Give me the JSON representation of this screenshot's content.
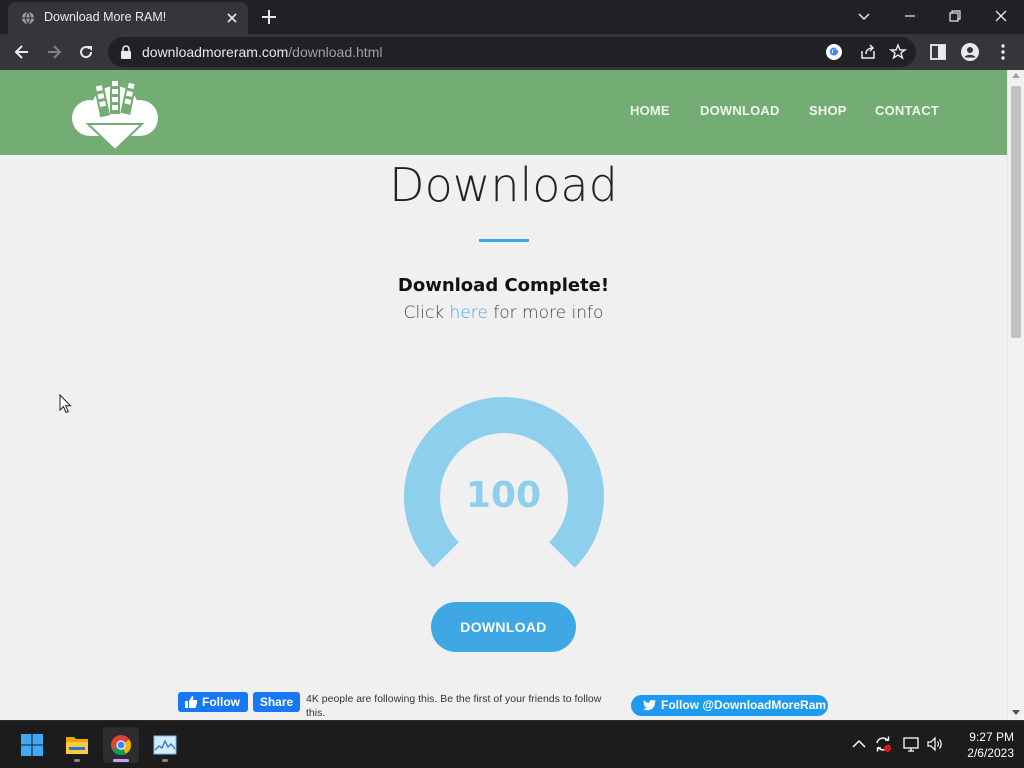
{
  "browser": {
    "tab_title": "Download More RAM!",
    "url_domain": "downloadmoreram.com",
    "url_path": "/download.html"
  },
  "site": {
    "nav": [
      "HOME",
      "DOWNLOAD",
      "SHOP",
      "CONTACT"
    ],
    "page_title": "Download",
    "status_heading": "Download Complete!",
    "info_prefix": "Click ",
    "info_link": "here",
    "info_suffix": " for more info",
    "progress_value": "100",
    "progress_fraction": 1.0,
    "download_button": "DOWNLOAD",
    "fb_follow": "Follow",
    "fb_share": "Share",
    "fb_text": "4K people are following this. Be the first of your friends to follow this.",
    "twitter_follow": "Follow @DownloadMoreRam"
  },
  "colors": {
    "header_green": "#74ad74",
    "accent_blue": "#3ea7e4",
    "gauge_blue": "#8ecfee"
  },
  "taskbar": {
    "apps": [
      "start-icon",
      "file-explorer-icon",
      "chrome-icon",
      "task-manager-icon"
    ],
    "time": "9:27 PM",
    "date": "2/6/2023"
  }
}
